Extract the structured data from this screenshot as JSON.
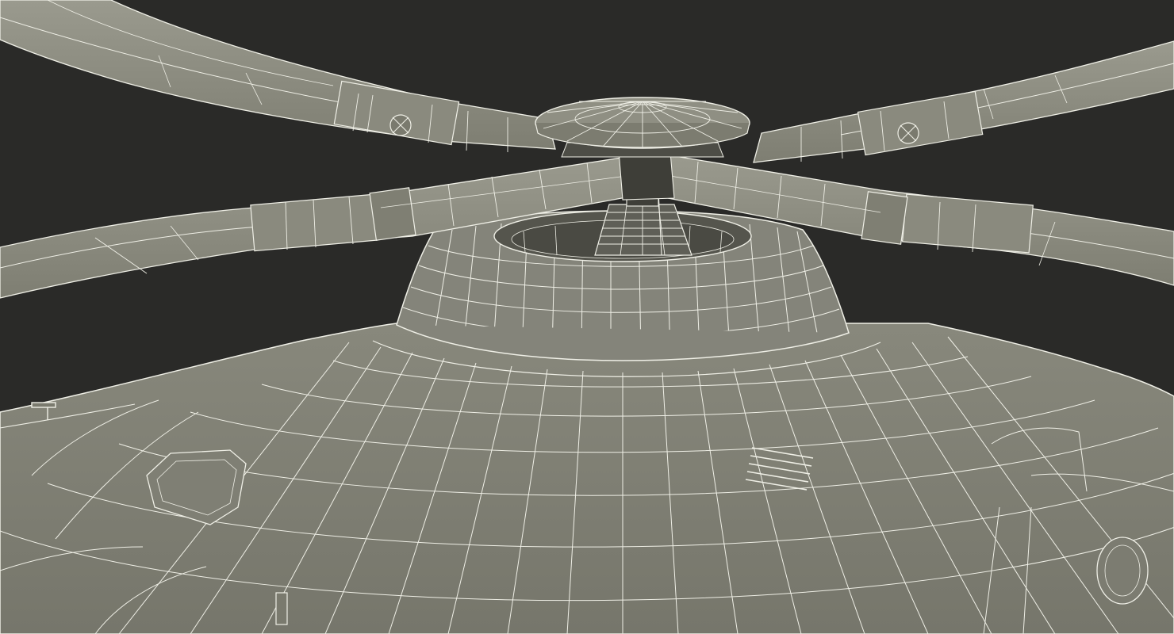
{
  "scene": {
    "subject": "helicopter-main-rotor-wireframe",
    "render_style": "wireframe-over-shaded",
    "colors": {
      "background": "#2a2a28",
      "surface_light": "#8d8d80",
      "surface_mid": "#7d7d71",
      "surface_dark": "#63635a",
      "wire": "#efefe6"
    }
  }
}
